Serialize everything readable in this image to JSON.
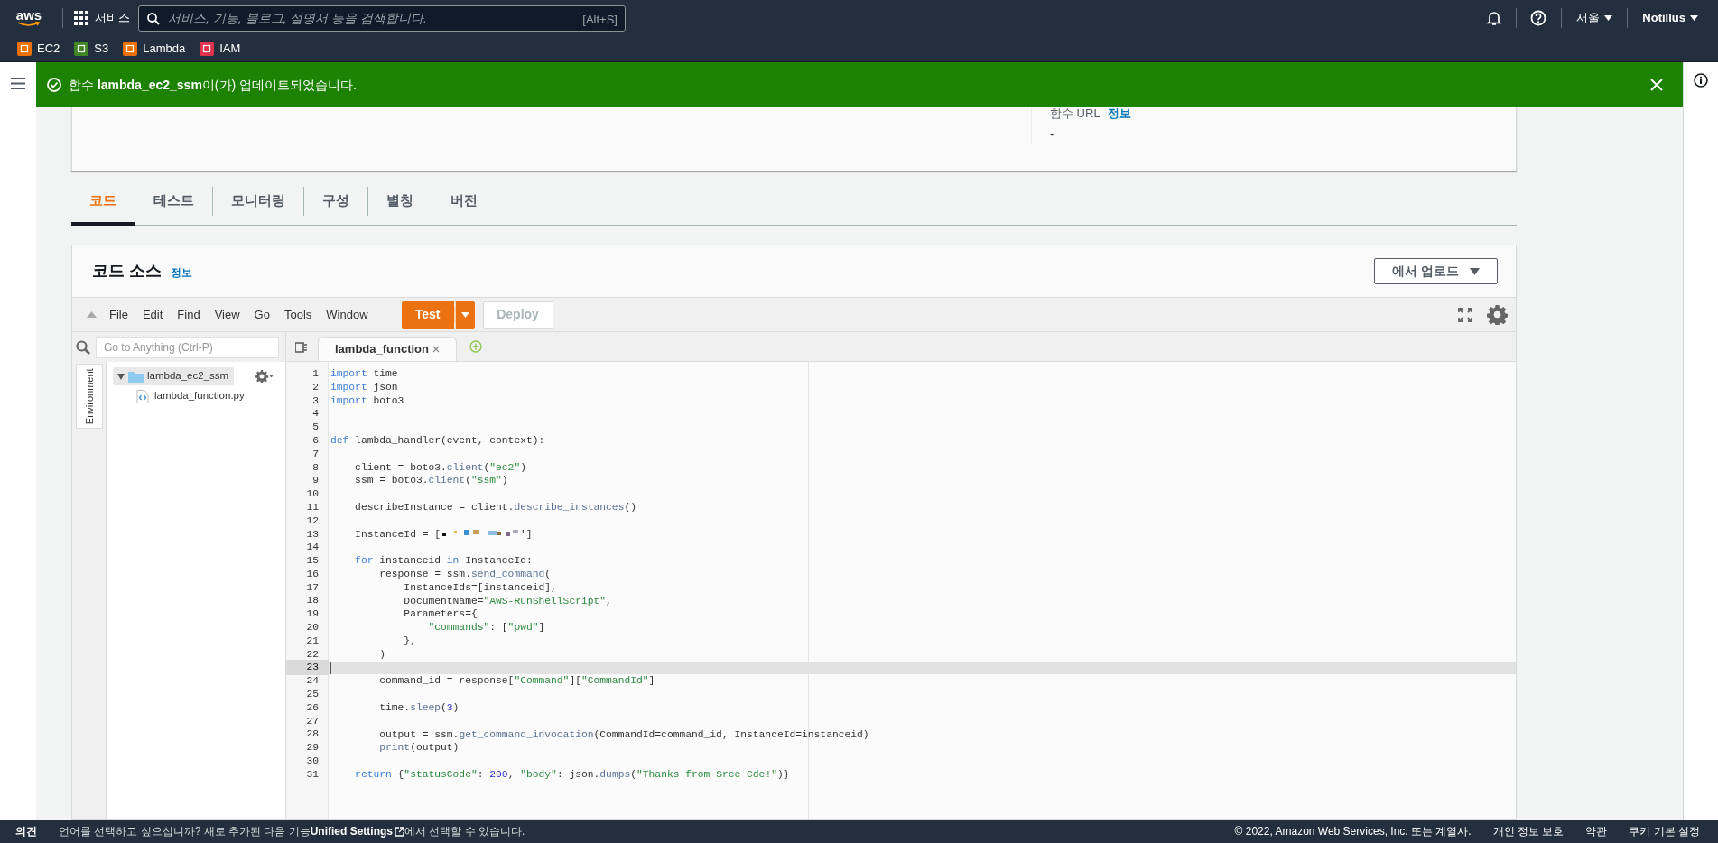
{
  "top_nav": {
    "logo": "aws",
    "services": "서비스",
    "search": {
      "placeholder": "서비스, 기능, 블로그, 설명서 등을 검색합니다.",
      "shortcut": "[Alt+S]"
    },
    "region": "서울",
    "account": "Notillus"
  },
  "favorites": [
    {
      "label": "EC2",
      "color": "#ed7100"
    },
    {
      "label": "S3",
      "color": "#3f8624"
    },
    {
      "label": "Lambda",
      "color": "#ed7100"
    },
    {
      "label": "IAM",
      "color": "#dd344c"
    }
  ],
  "flash": {
    "message": "함수 **lambda_ec2_ssm**이(가) 업데이트되었습니다."
  },
  "function_url": {
    "label": "함수 URL",
    "info": "정보",
    "value": "-"
  },
  "tabs": [
    {
      "label": "코드",
      "selected": true
    },
    {
      "label": "테스트",
      "selected": false
    },
    {
      "label": "모니터링",
      "selected": false
    },
    {
      "label": "구성",
      "selected": false
    },
    {
      "label": "별칭",
      "selected": false
    },
    {
      "label": "버전",
      "selected": false
    }
  ],
  "code_source": {
    "title": "코드 소스",
    "info": "정보",
    "upload_button": "에서 업로드",
    "menu": [
      "File",
      "Edit",
      "Find",
      "View",
      "Go",
      "Tools",
      "Window"
    ],
    "test_button": "Test",
    "deploy_button": {
      "label": "Deploy",
      "disabled": true
    },
    "search": {
      "placeholder": "Go to Anything (Ctrl-P)"
    },
    "side_tab": "Environment",
    "tree": [
      {
        "name": "lambda_ec2_ssm",
        "kind": "folder",
        "expanded": true,
        "children": [
          {
            "name": "lambda_function.py",
            "kind": "file"
          }
        ]
      }
    ],
    "editor_tabs": [
      {
        "label": "lambda_function",
        "selected": true
      }
    ],
    "lines": [
      {
        "number": "1",
        "current": false,
        "tokens": [
          {
            "kind": "keyword",
            "text": "import"
          },
          {
            "kind": "plain",
            "text": " time"
          }
        ]
      },
      {
        "number": "2",
        "current": false,
        "tokens": [
          {
            "kind": "keyword",
            "text": "import"
          },
          {
            "kind": "plain",
            "text": " json"
          }
        ]
      },
      {
        "number": "3",
        "current": false,
        "tokens": [
          {
            "kind": "keyword",
            "text": "import"
          },
          {
            "kind": "plain",
            "text": " boto3"
          }
        ]
      },
      {
        "number": "4",
        "current": false
      },
      {
        "number": "5",
        "current": false
      },
      {
        "number": "6",
        "current": false,
        "tokens": [
          {
            "kind": "keyword",
            "text": "def"
          },
          {
            "kind": "plain",
            "text": " lambda_handler(event, context):"
          }
        ]
      },
      {
        "number": "7",
        "current": false
      },
      {
        "number": "8",
        "current": false,
        "tokens": [
          {
            "kind": "plain",
            "text": "    client = boto3."
          },
          {
            "kind": "function",
            "text": "client"
          },
          {
            "kind": "plain",
            "text": "("
          },
          {
            "kind": "string",
            "text": "\"ec2\""
          },
          {
            "kind": "plain",
            "text": ")"
          }
        ]
      },
      {
        "number": "9",
        "current": false,
        "tokens": [
          {
            "kind": "plain",
            "text": "    ssm = boto3."
          },
          {
            "kind": "function",
            "text": "client"
          },
          {
            "kind": "plain",
            "text": "("
          },
          {
            "kind": "string",
            "text": "\"ssm\""
          },
          {
            "kind": "plain",
            "text": ")"
          }
        ]
      },
      {
        "number": "10",
        "current": false
      },
      {
        "number": "11",
        "current": false,
        "tokens": [
          {
            "kind": "plain",
            "text": "    describeInstance = client."
          },
          {
            "kind": "function",
            "text": "describe_instances"
          },
          {
            "kind": "plain",
            "text": "()"
          }
        ]
      },
      {
        "number": "12",
        "current": false
      },
      {
        "number": "13",
        "current": false,
        "tokens": [
          {
            "kind": "plain",
            "text": "    InstanceId = ["
          },
          {
            "kind": "redacted"
          },
          {
            "kind": "plain",
            "text": "']"
          }
        ]
      },
      {
        "number": "14",
        "current": false
      },
      {
        "number": "15",
        "current": false,
        "tokens": [
          {
            "kind": "keyword",
            "text": "    for"
          },
          {
            "kind": "plain",
            "text": " instanceid "
          },
          {
            "kind": "keyword",
            "text": "in"
          },
          {
            "kind": "plain",
            "text": " InstanceId:"
          }
        ]
      },
      {
        "number": "16",
        "current": false,
        "tokens": [
          {
            "kind": "plain",
            "text": "        response = ssm."
          },
          {
            "kind": "function",
            "text": "send_command"
          },
          {
            "kind": "plain",
            "text": "("
          }
        ]
      },
      {
        "number": "17",
        "current": false,
        "tokens": [
          {
            "kind": "plain",
            "text": "            InstanceIds=[instanceid],"
          }
        ]
      },
      {
        "number": "18",
        "current": false,
        "tokens": [
          {
            "kind": "plain",
            "text": "            DocumentName="
          },
          {
            "kind": "string",
            "text": "\"AWS-RunShellScript\""
          },
          {
            "kind": "plain",
            "text": ","
          }
        ]
      },
      {
        "number": "19",
        "current": false,
        "tokens": [
          {
            "kind": "plain",
            "text": "            Parameters={"
          }
        ]
      },
      {
        "number": "20",
        "current": false,
        "tokens": [
          {
            "kind": "string",
            "text": "                \"commands\""
          },
          {
            "kind": "plain",
            "text": ": ["
          },
          {
            "kind": "string",
            "text": "\"pwd\""
          },
          {
            "kind": "plain",
            "text": "]"
          }
        ]
      },
      {
        "number": "21",
        "current": false,
        "tokens": [
          {
            "kind": "plain",
            "text": "            },"
          }
        ]
      },
      {
        "number": "22",
        "current": false,
        "tokens": [
          {
            "kind": "plain",
            "text": "        )"
          }
        ]
      },
      {
        "number": "23",
        "current": true
      },
      {
        "number": "24",
        "current": false,
        "tokens": [
          {
            "kind": "plain",
            "text": "        command_id = response["
          },
          {
            "kind": "string",
            "text": "\"Command\""
          },
          {
            "kind": "plain",
            "text": "]["
          },
          {
            "kind": "string",
            "text": "\"CommandId\""
          },
          {
            "kind": "plain",
            "text": "]"
          }
        ]
      },
      {
        "number": "25",
        "current": false
      },
      {
        "number": "26",
        "current": false,
        "tokens": [
          {
            "kind": "plain",
            "text": "        time."
          },
          {
            "kind": "function",
            "text": "sleep"
          },
          {
            "kind": "plain",
            "text": "("
          },
          {
            "kind": "number",
            "text": "3"
          },
          {
            "kind": "plain",
            "text": ")"
          }
        ]
      },
      {
        "number": "27",
        "current": false
      },
      {
        "number": "28",
        "current": false,
        "tokens": [
          {
            "kind": "plain",
            "text": "        output = ssm."
          },
          {
            "kind": "function",
            "text": "get_command_invocation"
          },
          {
            "kind": "plain",
            "text": "(CommandId=command_id, InstanceId=instanceid)"
          }
        ]
      },
      {
        "number": "29",
        "current": false,
        "tokens": [
          {
            "kind": "function",
            "text": "        print"
          },
          {
            "kind": "plain",
            "text": "(output)"
          }
        ]
      },
      {
        "number": "30",
        "current": false
      },
      {
        "number": "31",
        "current": false,
        "tokens": [
          {
            "kind": "keyword",
            "text": "    return"
          },
          {
            "kind": "plain",
            "text": " {"
          },
          {
            "kind": "string",
            "text": "\"statusCode\""
          },
          {
            "kind": "plain",
            "text": ": "
          },
          {
            "kind": "number",
            "text": "200"
          },
          {
            "kind": "plain",
            "text": ", "
          },
          {
            "kind": "string",
            "text": "\"body\""
          },
          {
            "kind": "plain",
            "text": ": json."
          },
          {
            "kind": "function",
            "text": "dumps"
          },
          {
            "kind": "plain",
            "text": "("
          },
          {
            "kind": "string",
            "text": "\"Thanks from Srce Cde!\""
          },
          {
            "kind": "plain",
            "text": ")}"
          }
        ]
      }
    ]
  },
  "footer": {
    "feedback": "의견",
    "prompt_before": "언어를 선택하고 싶으십니까? 새로 추가된 다음 기능",
    "link": "Unified Settings",
    "prompt_after": "에서 선택할 수 있습니다.",
    "copyright": "© 2022, Amazon Web Services, Inc. 또는 계열사.",
    "links": [
      "개인 정보 보호",
      "약관",
      "쿠키 기본 설정"
    ]
  }
}
